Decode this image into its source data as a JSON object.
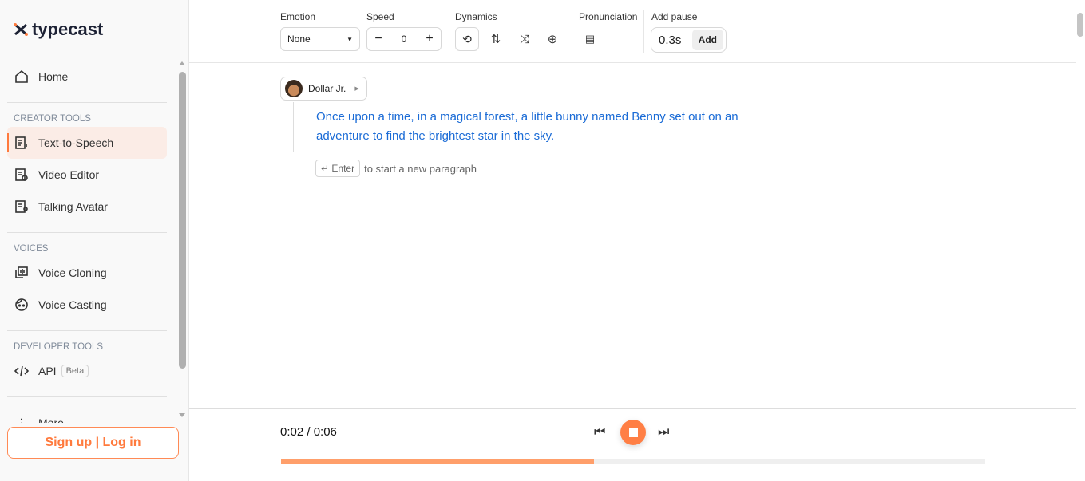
{
  "brand": {
    "name": "typecast",
    "accent": "#ff7a3d"
  },
  "sidebar": {
    "home": "Home",
    "sections": [
      {
        "title": "CREATOR TOOLS",
        "items": [
          {
            "label": "Text-to-Speech",
            "icon": "tts-icon",
            "active": true
          },
          {
            "label": "Video Editor",
            "icon": "video-editor-icon"
          },
          {
            "label": "Talking Avatar",
            "icon": "talking-avatar-icon"
          }
        ]
      },
      {
        "title": "VOICES",
        "items": [
          {
            "label": "Voice Cloning",
            "icon": "voice-cloning-icon"
          },
          {
            "label": "Voice Casting",
            "icon": "face-icon"
          }
        ]
      },
      {
        "title": "DEVELOPER TOOLS",
        "items": [
          {
            "label": "API",
            "icon": "code-icon",
            "badge": "Beta"
          }
        ]
      }
    ],
    "more": "More",
    "signup": "Sign up | Log in"
  },
  "toolbar": {
    "emotion": {
      "label": "Emotion",
      "value": "None"
    },
    "speed": {
      "label": "Speed",
      "value": "0"
    },
    "dynamics": {
      "label": "Dynamics"
    },
    "pronunciation": {
      "label": "Pronunciation"
    },
    "pause": {
      "label": "Add pause",
      "value": "0.3s",
      "button": "Add"
    }
  },
  "editor": {
    "voice": "Dollar Jr.",
    "text": "Once upon a time, in a magical forest, a little bunny named Benny set out on an adventure to find the brightest star in the sky.",
    "enter_key": "↵ Enter",
    "enter_hint": "to start a new paragraph"
  },
  "player": {
    "time": "0:02 / 0:06",
    "progress": 0.444
  }
}
